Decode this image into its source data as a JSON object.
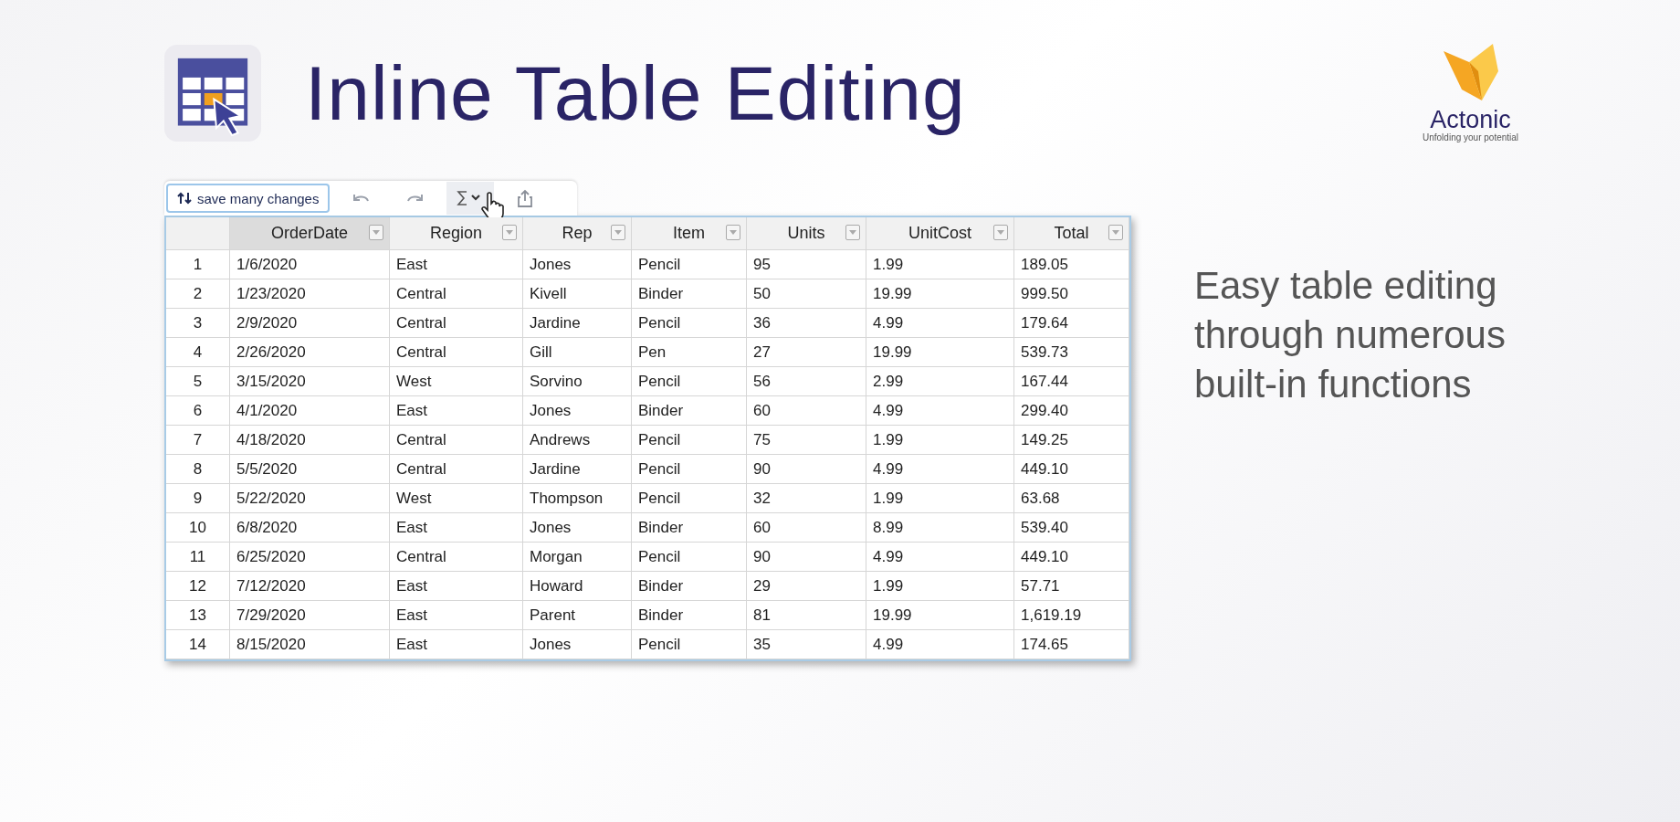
{
  "header": {
    "title": "Inline Table Editing"
  },
  "logo": {
    "name": "Actonic",
    "tagline": "Unfolding your potential"
  },
  "toolbar": {
    "save_label": "save many changes",
    "tools": [
      {
        "kind": "undo",
        "selected": false
      },
      {
        "kind": "redo",
        "selected": false
      },
      {
        "kind": "sum",
        "selected": true
      },
      {
        "kind": "export",
        "selected": false
      }
    ]
  },
  "table": {
    "columns": [
      {
        "label": "OrderDate",
        "selected": true
      },
      {
        "label": "Region",
        "selected": false
      },
      {
        "label": "Rep",
        "selected": false
      },
      {
        "label": "Item",
        "selected": false
      },
      {
        "label": "Units",
        "selected": false
      },
      {
        "label": "UnitCost",
        "selected": false
      },
      {
        "label": "Total",
        "selected": false
      }
    ],
    "rows": [
      [
        "1",
        "1/6/2020",
        "East",
        "Jones",
        "Pencil",
        "95",
        "1.99",
        "189.05"
      ],
      [
        "2",
        "1/23/2020",
        "Central",
        "Kivell",
        "Binder",
        "50",
        "19.99",
        "999.50"
      ],
      [
        "3",
        "2/9/2020",
        "Central",
        "Jardine",
        "Pencil",
        "36",
        "4.99",
        "179.64"
      ],
      [
        "4",
        "2/26/2020",
        "Central",
        "Gill",
        "Pen",
        "27",
        "19.99",
        "539.73"
      ],
      [
        "5",
        "3/15/2020",
        "West",
        "Sorvino",
        "Pencil",
        "56",
        "2.99",
        "167.44"
      ],
      [
        "6",
        "4/1/2020",
        "East",
        "Jones",
        "Binder",
        "60",
        "4.99",
        "299.40"
      ],
      [
        "7",
        "4/18/2020",
        "Central",
        "Andrews",
        "Pencil",
        "75",
        "1.99",
        "149.25"
      ],
      [
        "8",
        "5/5/2020",
        "Central",
        "Jardine",
        "Pencil",
        "90",
        "4.99",
        "449.10"
      ],
      [
        "9",
        "5/22/2020",
        "West",
        "Thompson",
        "Pencil",
        "32",
        "1.99",
        "63.68"
      ],
      [
        "10",
        "6/8/2020",
        "East",
        "Jones",
        "Binder",
        "60",
        "8.99",
        "539.40"
      ],
      [
        "11",
        "6/25/2020",
        "Central",
        "Morgan",
        "Pencil",
        "90",
        "4.99",
        "449.10"
      ],
      [
        "12",
        "7/12/2020",
        "East",
        "Howard",
        "Binder",
        "29",
        "1.99",
        "57.71"
      ],
      [
        "13",
        "7/29/2020",
        "East",
        "Parent",
        "Binder",
        "81",
        "19.99",
        "1,619.19"
      ],
      [
        "14",
        "8/15/2020",
        "East",
        "Jones",
        "Pencil",
        "35",
        "4.99",
        "174.65"
      ]
    ]
  },
  "tagline_lines": [
    "Easy table editing",
    "through numerous",
    "built-in functions"
  ]
}
